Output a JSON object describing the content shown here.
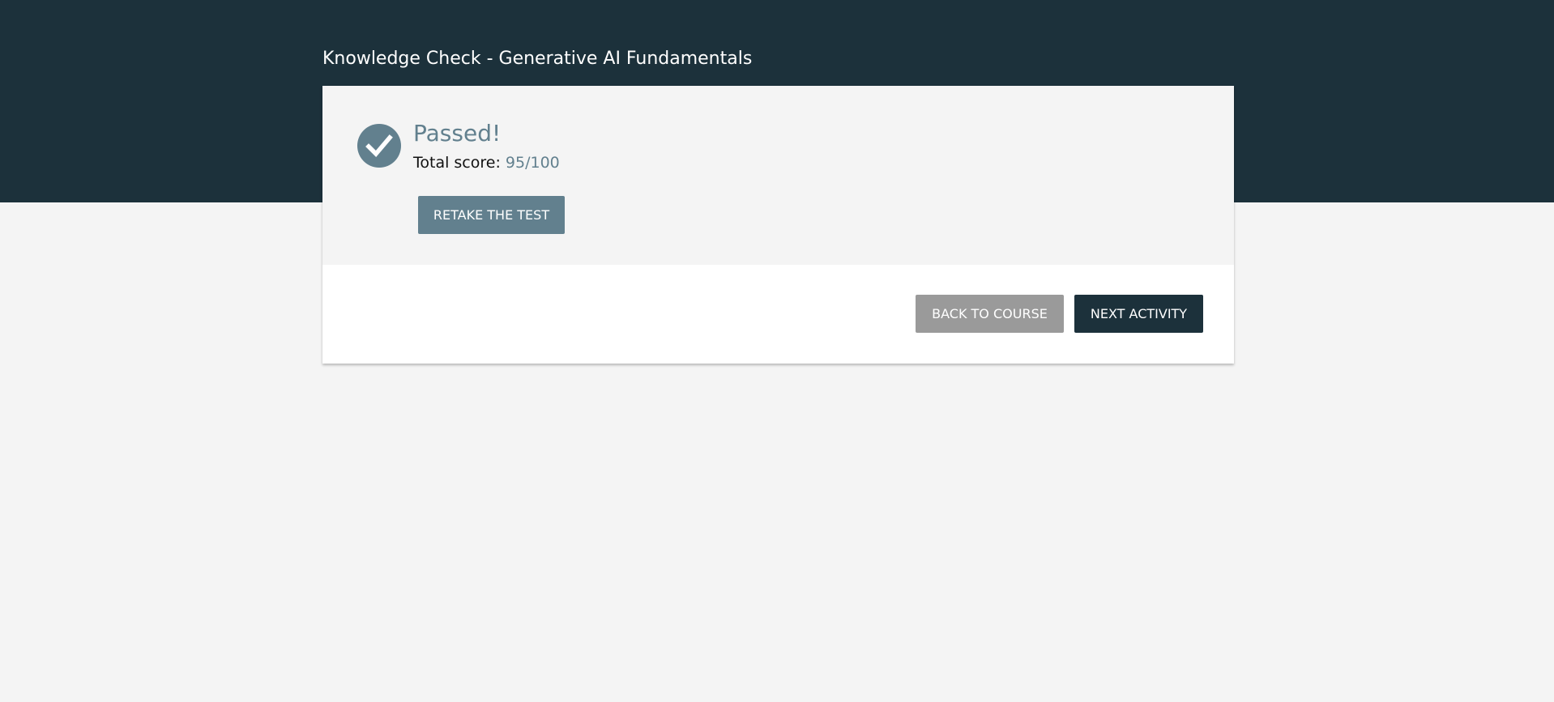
{
  "header": {
    "title": "Knowledge Check - Generative AI Fundamentals"
  },
  "result": {
    "status": "Passed!",
    "score_label": "Total score:",
    "score_value": "95/100",
    "icon": "check-circle-icon"
  },
  "actions": {
    "retake_label": "RETAKE THE TEST",
    "back_label": "BACK TO COURSE",
    "next_label": "NEXT ACTIVITY"
  },
  "colors": {
    "header_background": "#1c313b",
    "accent": "#62808e",
    "page_background": "#f4f4f4",
    "secondary_button": "#9a9a9a",
    "primary_button": "#1c313b"
  }
}
